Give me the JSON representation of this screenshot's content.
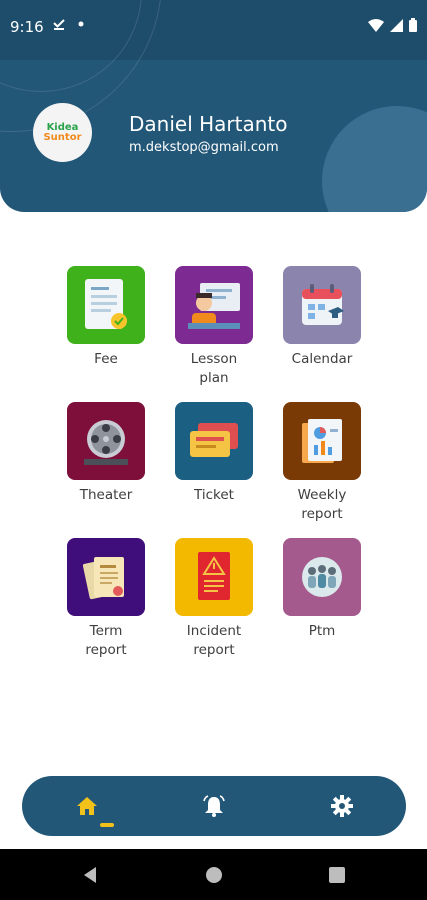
{
  "status_bar": {
    "time": "9:16"
  },
  "profile": {
    "name": "Daniel Hartanto",
    "email": "m.dekstop@gmail.com",
    "logo_line1": "Kidea",
    "logo_line2": "Suntor"
  },
  "menu": [
    {
      "label": "Fee",
      "icon": "fee-document-icon",
      "color": "#3fb11a"
    },
    {
      "label": "Lesson\nplan",
      "icon": "teacher-board-icon",
      "color": "#7d2b93"
    },
    {
      "label": "Calendar",
      "icon": "calendar-icon",
      "color": "#8b84ad"
    },
    {
      "label": "Theater",
      "icon": "film-reel-icon",
      "color": "#7d0f3a"
    },
    {
      "label": "Ticket",
      "icon": "ticket-icon",
      "color": "#1b5f82"
    },
    {
      "label": "Weekly\nreport",
      "icon": "report-chart-icon",
      "color": "#7a3a05"
    },
    {
      "label": "Term\nreport",
      "icon": "report-cards-icon",
      "color": "#3f0e7a"
    },
    {
      "label": "Incident\nreport",
      "icon": "incident-warning-icon",
      "color": "#f3b800"
    },
    {
      "label": "Ptm",
      "icon": "parent-teacher-meeting-icon",
      "color": "#a45a8c"
    }
  ],
  "bottom_nav": [
    {
      "icon": "home-icon",
      "active": true
    },
    {
      "icon": "alarm-bell-icon",
      "active": false
    },
    {
      "icon": "settings-gear-icon",
      "active": false
    }
  ],
  "colors": {
    "primary": "#235778",
    "accent": "#f2c21b"
  }
}
